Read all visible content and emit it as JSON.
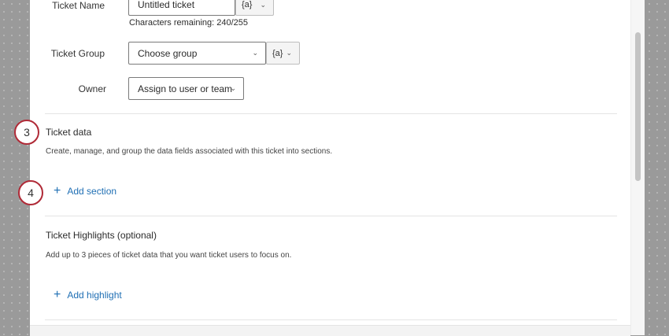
{
  "form": {
    "ticket_name": {
      "label": "Ticket Name",
      "value": "Untitled ticket",
      "pipe_label": "{a}",
      "helper": "Characters remaining: 240/255"
    },
    "ticket_group": {
      "label": "Ticket Group",
      "value": "Choose group",
      "pipe_label": "{a}"
    },
    "owner": {
      "label": "Owner",
      "value": "Assign to user or team"
    }
  },
  "ticket_data": {
    "step": "3",
    "title": "Ticket data",
    "description": "Create, manage, and group the data fields associated with this ticket into sections.",
    "add_step": "4",
    "add_label": "Add section"
  },
  "highlights": {
    "title": "Ticket Highlights (optional)",
    "description": "Add up to 3 pieces of ticket data that you want ticket users to focus on.",
    "add_label": "Add highlight"
  },
  "icons": {
    "chevron": "chevron-down-icon",
    "plus": "plus-icon"
  },
  "colors": {
    "link": "#1f6fb4",
    "step_border": "#b02a37"
  }
}
